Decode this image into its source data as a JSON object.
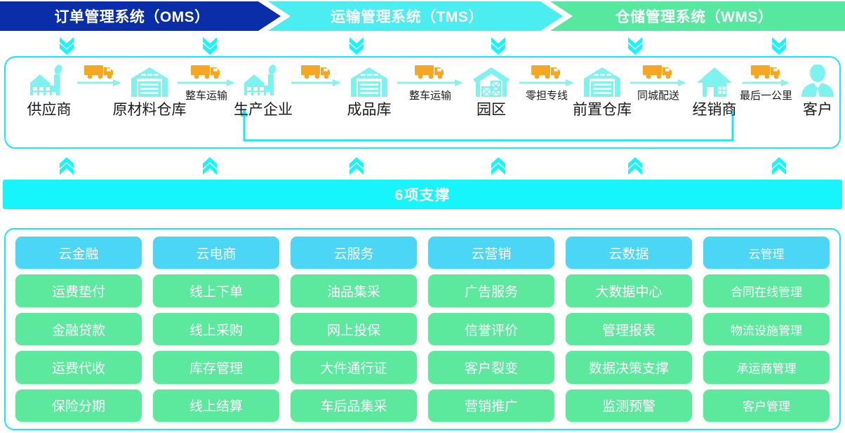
{
  "banner": {
    "segments": [
      {
        "label": "订单管理系统（OMS）",
        "color": "#0A2DA8"
      },
      {
        "label": "运输管理系统（TMS）",
        "color": "#4BEDF0"
      },
      {
        "label": "仓储管理系统（WMS）",
        "color": "#57E8A0"
      }
    ]
  },
  "chevrons": {
    "down_icon": "chevron-double-down-icon",
    "up_icon": "chevron-double-up-icon",
    "color": "#15F5FB",
    "count": 6
  },
  "flow": {
    "nodes": [
      {
        "label": "供应商",
        "icon": "factory-icon"
      },
      {
        "label": "原材料仓库",
        "icon": "warehouse-icon"
      },
      {
        "label": "生产企业",
        "icon": "factory-icon"
      },
      {
        "label": "成品库",
        "icon": "warehouse-icon"
      },
      {
        "label": "园区",
        "icon": "industrial-park-icon"
      },
      {
        "label": "前置仓库",
        "icon": "warehouse-icon"
      },
      {
        "label": "经销商",
        "icon": "house-icon"
      },
      {
        "label": "客户",
        "icon": "customer-person-icon"
      }
    ],
    "links": [
      {
        "label": "",
        "icon": "truck-icon"
      },
      {
        "label": "整车运输",
        "icon": "truck-icon"
      },
      {
        "label": "",
        "icon": "truck-icon"
      },
      {
        "label": "整车运输",
        "icon": "truck-icon"
      },
      {
        "label": "零担专线",
        "icon": "truck-icon"
      },
      {
        "label": "同城配送",
        "icon": "truck-icon"
      },
      {
        "label": "最后一公里",
        "icon": "truck-icon"
      }
    ],
    "return_path": {
      "name": "reverse-logistics-arrow",
      "from": "经销商",
      "to": "生产企业"
    },
    "colors": {
      "icon": "#7DF2EE",
      "truck": "#F5A623",
      "arrow": "#8FEFEA",
      "border": "#19E7F7"
    }
  },
  "support_bar": {
    "label": "6项支撑",
    "color": "#15F5FB"
  },
  "grid": {
    "head_color": "#4CD6F5",
    "item_color": "#5CE89D",
    "columns": [
      {
        "head": "云金融",
        "items": [
          "运费垫付",
          "金融贷款",
          "运费代收",
          "保险分期"
        ]
      },
      {
        "head": "云电商",
        "items": [
          "线上下单",
          "线上采购",
          "库存管理",
          "线上结算"
        ]
      },
      {
        "head": "云服务",
        "items": [
          "油品集采",
          "网上投保",
          "大件通行证",
          "车后品集采"
        ]
      },
      {
        "head": "云营销",
        "items": [
          "广告服务",
          "信誉评价",
          "客户裂变",
          "营销推广"
        ]
      },
      {
        "head": "云数据",
        "items": [
          "大数据中心",
          "管理报表",
          "数据决策支撑",
          "监测预警"
        ]
      },
      {
        "head": "云管理",
        "items": [
          "合同在线管理",
          "物流设施管理",
          "承运商管理",
          "客户管理"
        ]
      }
    ]
  }
}
